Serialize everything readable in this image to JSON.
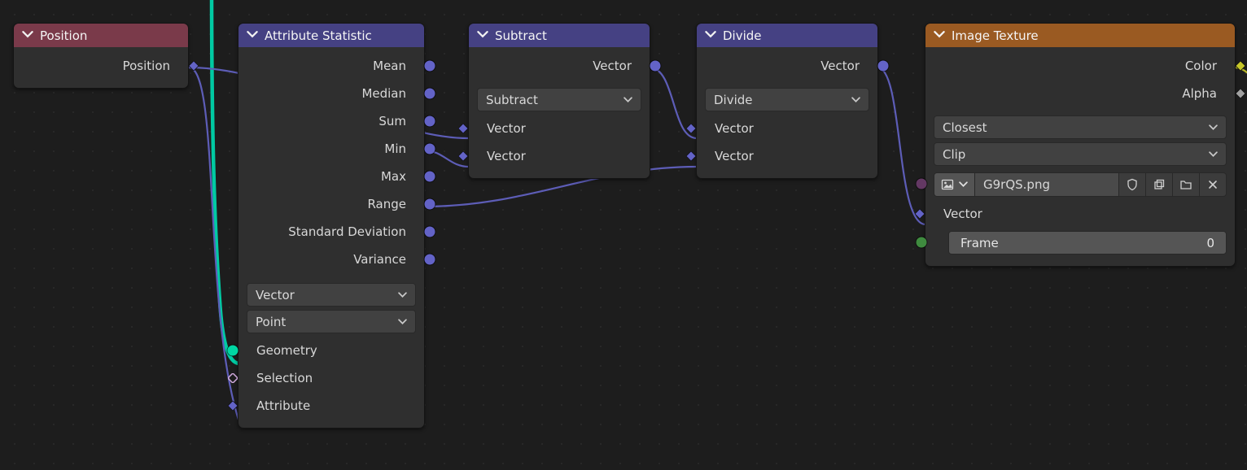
{
  "colors": {
    "hdr_red": "#7a3a4a",
    "hdr_blue": "#454183",
    "hdr_orange": "#9a5a22",
    "socket_vector": "#6363c7",
    "socket_geometry": "#00d6a3",
    "socket_color": "#c7c729",
    "socket_float": "#a1a1a1",
    "socket_image": "#633863",
    "socket_int": "#3f8b3f"
  },
  "nodes": {
    "position": {
      "title": "Position",
      "outputs": {
        "position": "Position"
      }
    },
    "attr_stat": {
      "title": "Attribute Statistic",
      "outputs": {
        "mean": "Mean",
        "median": "Median",
        "sum": "Sum",
        "min": "Min",
        "max": "Max",
        "range": "Range",
        "std": "Standard Deviation",
        "var": "Variance"
      },
      "data_type": "Vector",
      "domain": "Point",
      "inputs": {
        "geometry": "Geometry",
        "selection": "Selection",
        "attribute": "Attribute"
      }
    },
    "subtract": {
      "title": "Subtract",
      "outputs": {
        "vector": "Vector"
      },
      "operation": "Subtract",
      "inputs": {
        "a": "Vector",
        "b": "Vector"
      }
    },
    "divide": {
      "title": "Divide",
      "outputs": {
        "vector": "Vector"
      },
      "operation": "Divide",
      "inputs": {
        "a": "Vector",
        "b": "Vector"
      }
    },
    "image_texture": {
      "title": "Image Texture",
      "outputs": {
        "color": "Color",
        "alpha": "Alpha"
      },
      "interpolation": "Closest",
      "extension": "Clip",
      "image_name": "G9rQS.png",
      "inputs": {
        "vector": "Vector"
      },
      "frame_label": "Frame",
      "frame_value": "0"
    }
  }
}
